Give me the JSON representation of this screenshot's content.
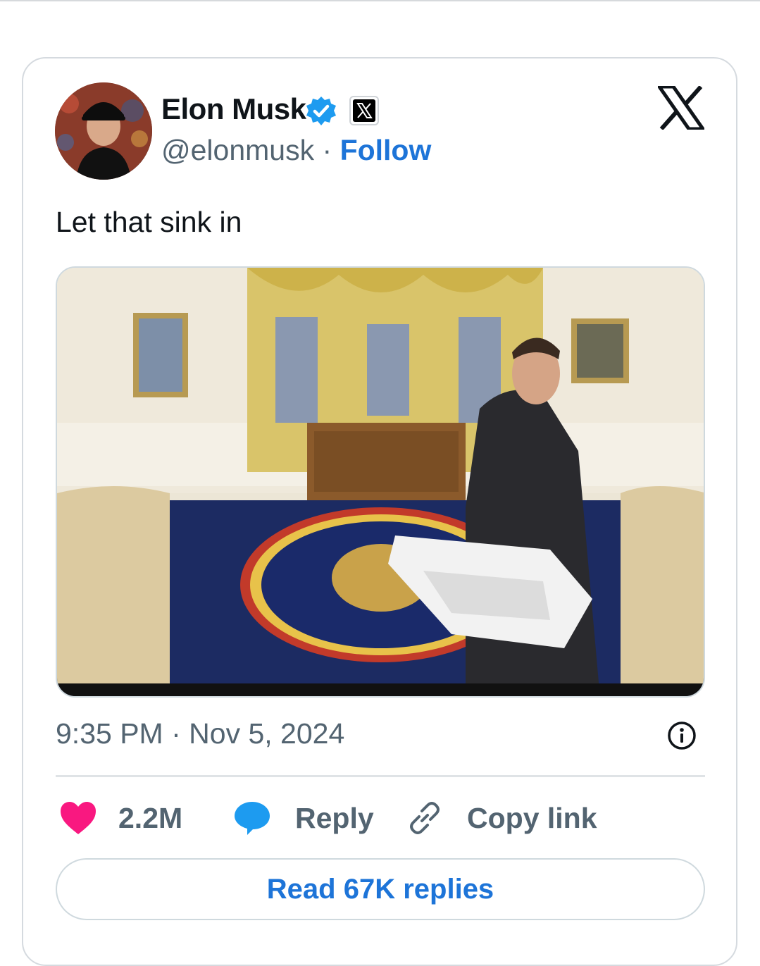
{
  "author": {
    "name": "Elon Musk",
    "handle": "@elonmusk",
    "separator": "·",
    "follow_label": "Follow",
    "verified_icon": "verified-badge-icon",
    "affiliate_icon": "x-affiliate-badge-icon"
  },
  "tweet": {
    "text": "Let that sink in",
    "time": "9:35 PM",
    "separator": "·",
    "date": "Nov 5, 2024"
  },
  "actions": {
    "like_count": "2.2M",
    "reply_label": "Reply",
    "copy_label": "Copy link"
  },
  "read_replies_label": "Read 67K replies",
  "colors": {
    "accent": "#1d74d8",
    "like": "#f91880",
    "reply_bubble": "#1d9bf0",
    "secondary_text": "#536471"
  }
}
